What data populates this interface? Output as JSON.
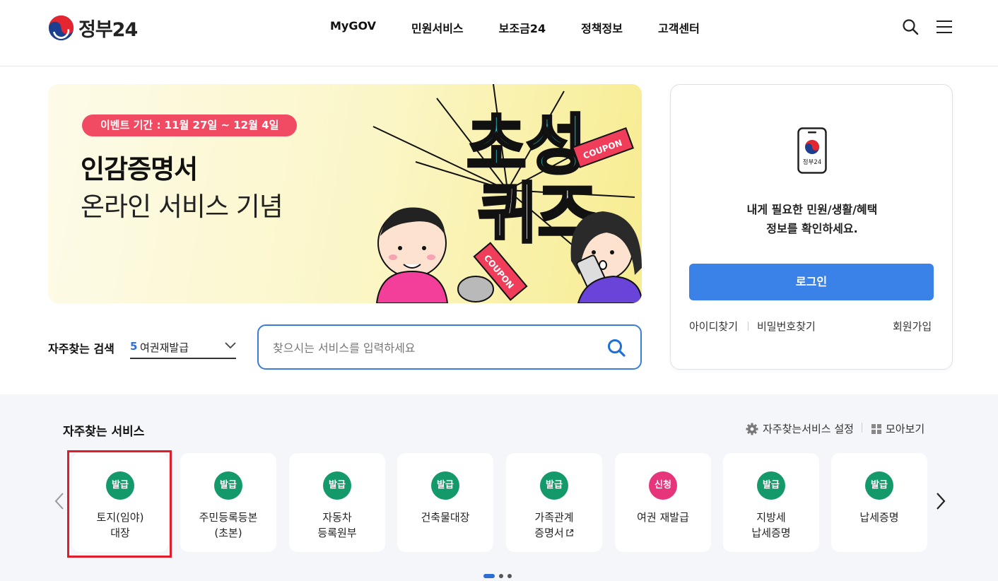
{
  "header": {
    "logo_text": "정부24",
    "nav": [
      "MyGOV",
      "민원서비스",
      "보조금24",
      "정책정보",
      "고객센터"
    ]
  },
  "banner": {
    "event_period": "이벤트 기간 : 11월 27일 ~ 12월 4일",
    "title": "인감증명서",
    "subtitle": "온라인 서비스 기념",
    "art_title_top": "초성",
    "art_title_bottom": "퀴즈",
    "coupon_label": "COUPON"
  },
  "login": {
    "phone_label": "정부24",
    "message_line1": "내게 필요한 민원/생활/혜택",
    "message_line2": "정보를 확인하세요.",
    "button": "로그인",
    "find_id": "아이디찾기",
    "find_pw": "비밀번호찾기",
    "signup": "회원가입"
  },
  "frequent_search": {
    "label": "자주찾는 검색",
    "rank": "5",
    "selected": "여권재발급",
    "placeholder": "찾으시는 서비스를 입력하세요"
  },
  "services": {
    "title": "자주찾는 서비스",
    "settings": "자주찾는서비스 설정",
    "view_all": "모아보기",
    "items": [
      {
        "badge": "발급",
        "line1": "토지(임야)",
        "line2": "대장",
        "color": "#14996b"
      },
      {
        "badge": "발급",
        "line1": "주민등록등본",
        "line2": "(초본)",
        "color": "#14996b"
      },
      {
        "badge": "발급",
        "line1": "자동차",
        "line2": "등록원부",
        "color": "#14996b"
      },
      {
        "badge": "발급",
        "line1": "건축물대장",
        "line2": "",
        "color": "#14996b"
      },
      {
        "badge": "발급",
        "line1": "가족관계",
        "line2": "증명서",
        "color": "#14996b"
      },
      {
        "badge": "신청",
        "line1": "여권 재발급",
        "line2": "",
        "color": "#e6357a"
      },
      {
        "badge": "발급",
        "line1": "지방세",
        "line2": "납세증명",
        "color": "#14996b"
      },
      {
        "badge": "발급",
        "line1": "납세증명",
        "line2": "",
        "color": "#14996b"
      }
    ]
  }
}
